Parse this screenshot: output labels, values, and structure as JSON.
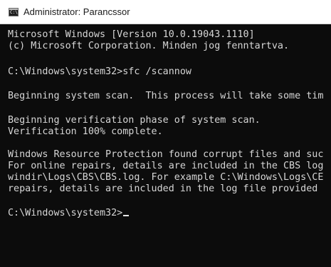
{
  "window": {
    "title": "Administrator: Parancssor",
    "icon_name": "command-prompt-icon",
    "icon_glyph": "C:\\"
  },
  "console": {
    "lines": [
      "Microsoft Windows [Version 10.0.19043.1110]",
      "(c) Microsoft Corporation. Minden jog fenntartva.",
      "C:\\Windows\\system32>sfc /scannow",
      "Beginning system scan.  This process will take some tim",
      "Beginning verification phase of system scan.",
      "Verification 100% complete.",
      "Windows Resource Protection found corrupt files and suc",
      "For online repairs, details are included in the CBS log",
      "windir\\Logs\\CBS\\CBS.log. For example C:\\Windows\\Logs\\CE",
      "repairs, details are included in the log file provided",
      "C:\\Windows\\system32>"
    ]
  },
  "colors": {
    "console_background": "#0c0c0c",
    "console_text": "#d6d6d6",
    "titlebar_background": "#ffffff"
  }
}
